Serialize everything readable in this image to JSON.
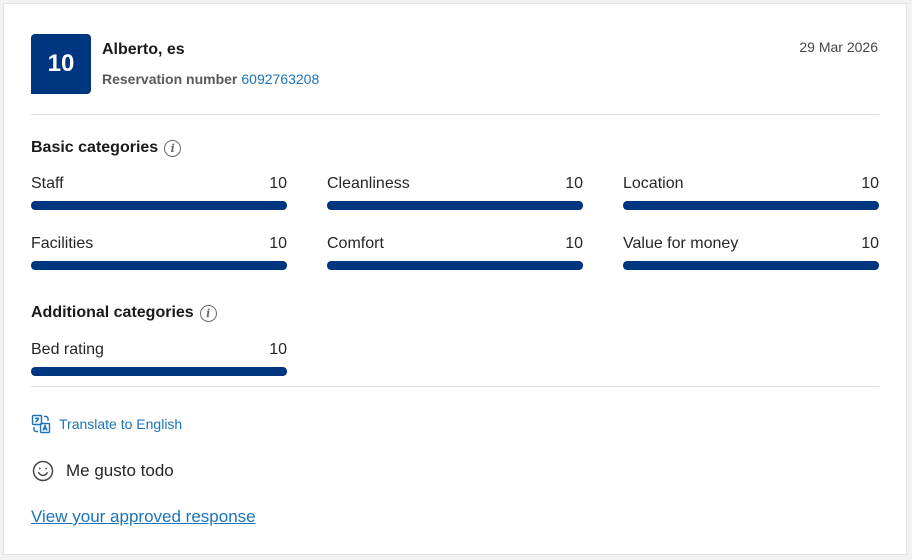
{
  "review": {
    "score": "10",
    "reviewer": "Alberto, es",
    "reservation_label": "Reservation number",
    "reservation_number": "6092763208",
    "date": "29 Mar 2026"
  },
  "basic": {
    "title": "Basic categories",
    "items": [
      {
        "label": "Staff",
        "value": "10",
        "fraction": 1.0
      },
      {
        "label": "Cleanliness",
        "value": "10",
        "fraction": 1.0
      },
      {
        "label": "Location",
        "value": "10",
        "fraction": 1.0
      },
      {
        "label": "Facilities",
        "value": "10",
        "fraction": 1.0
      },
      {
        "label": "Comfort",
        "value": "10",
        "fraction": 1.0
      },
      {
        "label": "Value for money",
        "value": "10",
        "fraction": 1.0
      }
    ]
  },
  "additional": {
    "title": "Additional categories",
    "items": [
      {
        "label": "Bed rating",
        "value": "10",
        "fraction": 1.0
      }
    ]
  },
  "translate_label": "Translate to English",
  "comment": "Me gusto todo",
  "response_link": "View your approved response",
  "colors": {
    "brand": "#003580",
    "link": "#1a73b9"
  },
  "icons": {
    "info": "info-icon",
    "translate": "translate-icon",
    "comment": "smiley-icon"
  }
}
